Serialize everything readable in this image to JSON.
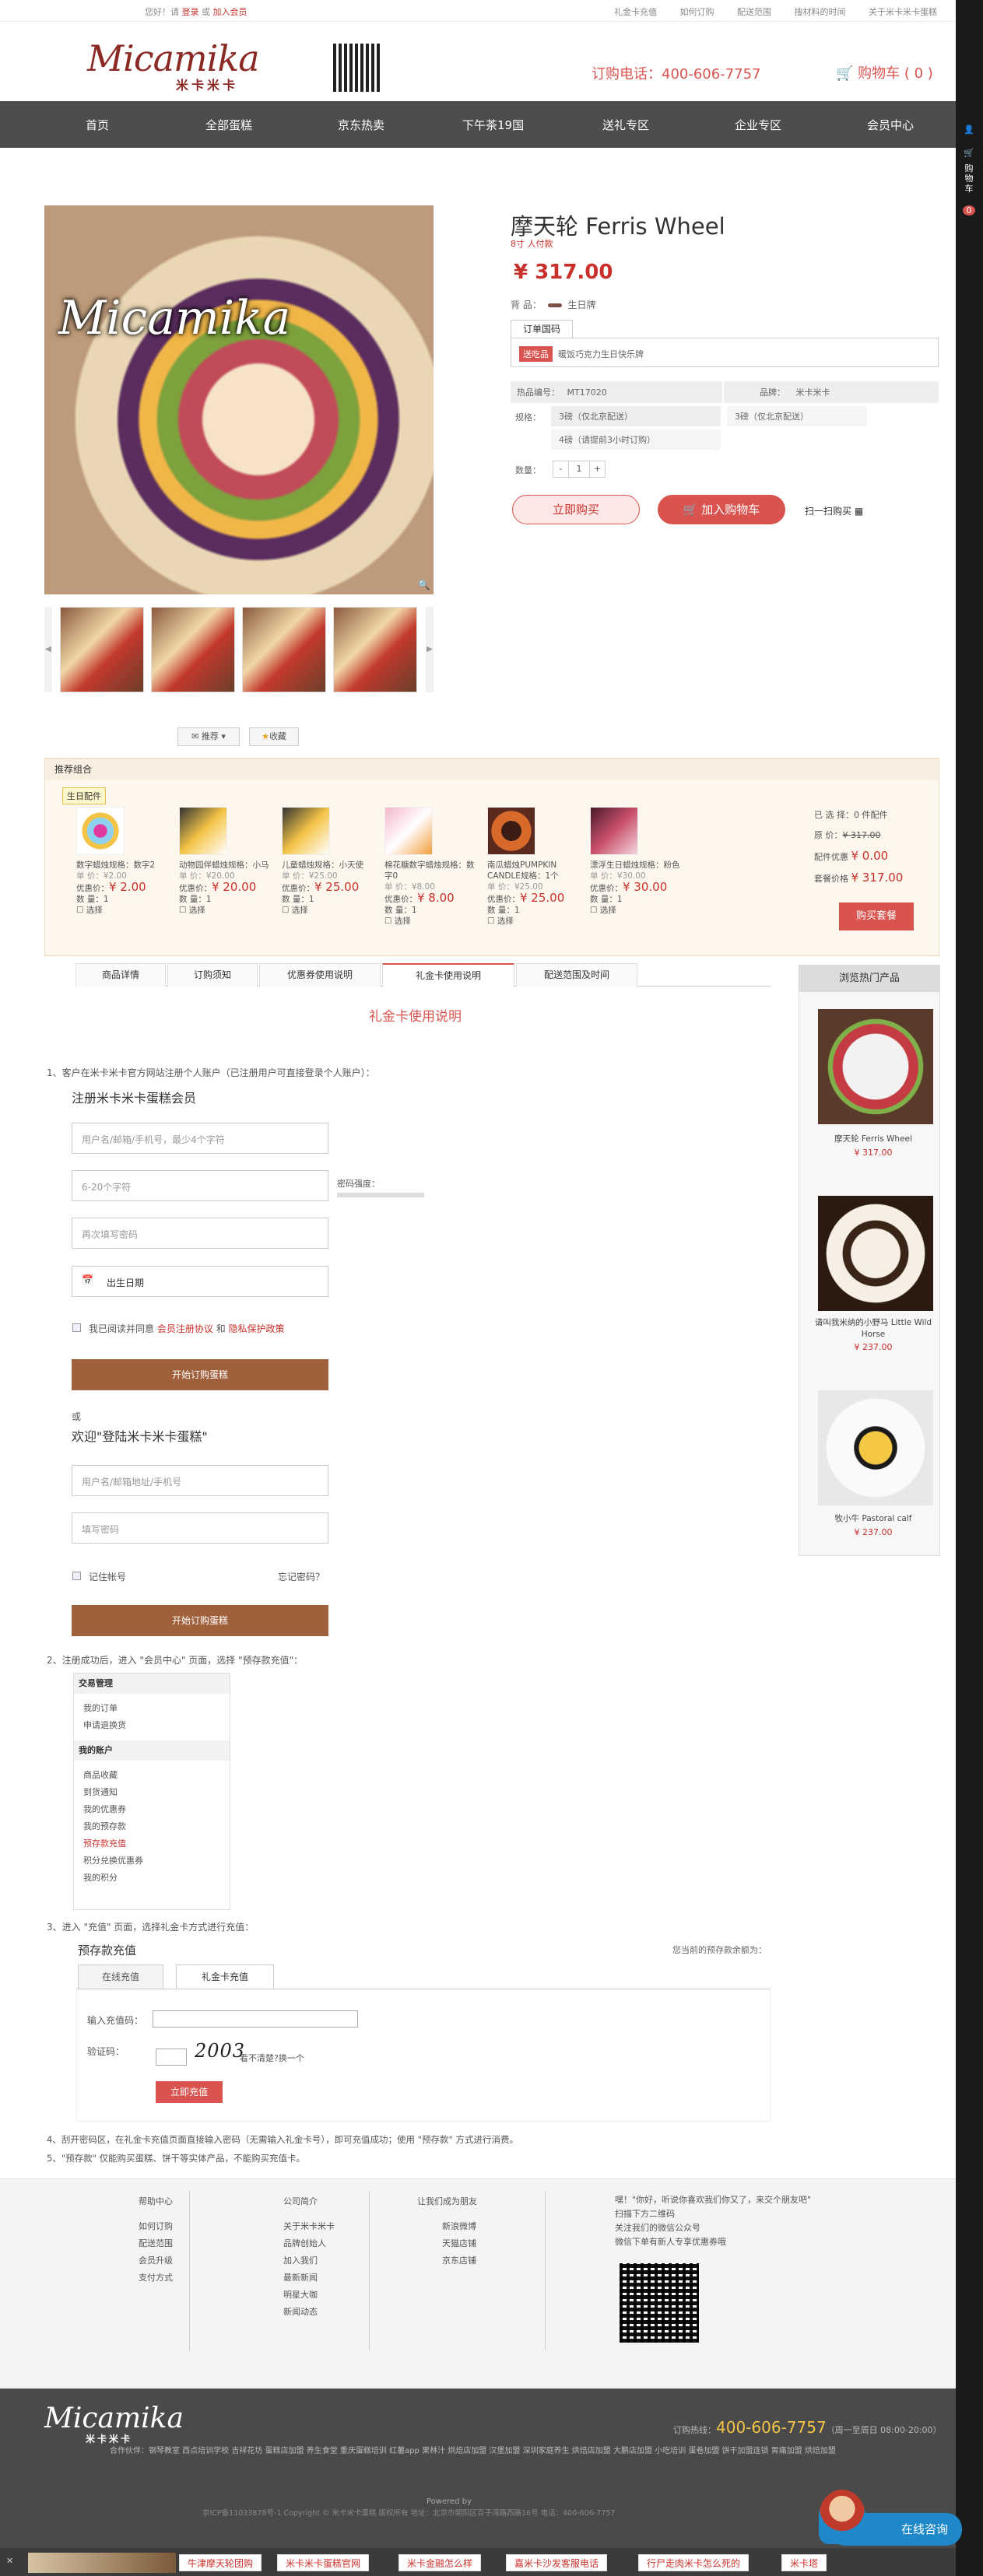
{
  "topbar": {
    "greet": "您好！请",
    "login": "登录",
    "or": "或",
    "register": "加入会员",
    "links": [
      "礼金卡充值",
      "如何订购",
      "配送范围",
      "搜材料的时间",
      "关于米卡米卡蛋糕"
    ]
  },
  "header": {
    "logo": "Micamika",
    "logo_cn": "米卡米卡",
    "hotline": "订购电话：400-606-7757",
    "cart": "购物车 ( 0 )"
  },
  "nav": [
    "首页",
    "全部蛋糕",
    "京东热卖",
    "下午茶19国",
    "送礼专区",
    "企业专区",
    "会员中心"
  ],
  "sidebar": {
    "label": "购物车",
    "count": "0"
  },
  "product": {
    "title": "摩天轮 Ferris Wheel",
    "sub": "8寸 人付款",
    "price": "¥ 317.00",
    "brand_label": "背  品：",
    "brand_value": "生日牌",
    "order_tab": "订单国码",
    "order_tag": "送吃品",
    "order_text": "暖饭巧克力生日快乐牌",
    "sku_label": "热品编号：",
    "sku": "MT17020",
    "brand_k": "品牌：",
    "brand_v": "米卡米卡",
    "spec_label": "规格：",
    "specs": [
      "3磅（仅北京配送）",
      "3磅（仅北京配送）",
      "4磅（请提前3小时订购）"
    ],
    "qty_label": "数量：",
    "qty": "1",
    "buy": "立即购买",
    "add_cart": "加入购物车",
    "scan": "扫一扫购买",
    "share": "推荐",
    "fav": "收藏"
  },
  "combo": {
    "title": "推荐组合",
    "tag": "生日配件",
    "items": [
      {
        "name": "数字蜡烛规格：数字2",
        "unit": "单  价：¥2.00",
        "price": "¥ 2.00",
        "qty": "数  量：1",
        "sel": "选择"
      },
      {
        "name": "动物园伴蜡烛规格：小马",
        "unit": "单  价：¥20.00",
        "price": "¥ 20.00",
        "qty": "数  量：1",
        "sel": "选择"
      },
      {
        "name": "儿童蜡烛规格：小天使",
        "unit": "单  价：¥25.00",
        "price": "¥ 25.00",
        "qty": "数  量：1",
        "sel": "选择"
      },
      {
        "name": "棉花糖数字蜡烛规格：数字0",
        "unit": "单  价：¥8.00",
        "price": "¥ 8.00",
        "qty": "数  量：1",
        "sel": "选择"
      },
      {
        "name": "南瓜蜡烛PUMPKIN CANDLE规格：1个",
        "unit": "单  价：¥25.00",
        "price": "¥ 25.00",
        "qty": "数  量：1",
        "sel": "选择"
      },
      {
        "name": "漂浮生日蜡烛规格：粉色",
        "unit": "单  价：¥30.00",
        "price": "¥ 30.00",
        "qty": "数  量：1",
        "sel": "选择"
      }
    ],
    "discount_label": "优惠价：",
    "selected": "已 选 择：0 件配件",
    "orig_label": "原  价：",
    "orig": "¥ 317.00",
    "save_label": "配件优惠",
    "save": "¥ 0.00",
    "set_label": "套餐价格",
    "set": "¥ 317.00",
    "buy": "购买套餐"
  },
  "tabs": [
    "商品详情",
    "订购须知",
    "优惠券使用说明",
    "礼金卡使用说明",
    "配送范围及时间"
  ],
  "gift": {
    "title": "礼金卡使用说明",
    "step1": "1、客户在米卡米卡官方网站注册个人账户（已注册用户可直接登录个人账户）：",
    "reg_title": "注册米卡米卡蛋糕会员",
    "reg_ph": [
      "用户名/邮箱/手机号，最少4个字符",
      "6-20个字符",
      "再次填写密码"
    ],
    "strength": "密码强度：",
    "birthday": "出生日期",
    "agree": "我已阅读并同意",
    "agree_link1": "会员注册协议",
    "agree_and": "和",
    "agree_link2": "隐私保护政策",
    "reg_btn": "开始订购蛋糕",
    "or": "或",
    "login_title": "欢迎\"登陆米卡米卡蛋糕\"",
    "login_ph": [
      "用户名/邮箱地址/手机号",
      "填写密码"
    ],
    "remember": "记住帐号",
    "forgot": "忘记密码？",
    "login_btn": "开始订购蛋糕",
    "step2": "2、注册成功后，进入 \"会员中心\" 页面，选择 \"预存款充值\"：",
    "menu": {
      "h1": "交易管理",
      "g1": [
        "我的订单",
        "申请退换货"
      ],
      "h2": "我的账户",
      "g2": [
        "商品收藏",
        "到货通知",
        "我的优惠券",
        "我的预存款",
        "预存款充值",
        "积分兑换优惠券",
        "我的积分"
      ]
    },
    "step3": "3、进入 \"充值\" 页面，选择礼金卡方式进行充值：",
    "recharge_title": "预存款充值",
    "balance": "您当前的预存款余额为：",
    "rtab1": "在线充值",
    "rtab2": "礼金卡充值",
    "code_label": "输入充值码：",
    "captcha_label": "验证码：",
    "captcha": "2003",
    "captcha_hint": "看不清楚?换一个",
    "rbtn": "立即充值",
    "step4": "4、刮开密码区，在礼金卡充值页面直接输入密码（无需输入礼金卡号），即可充值成功；使用 \"预存款\" 方式进行消费。",
    "step5": "5、\"预存款\" 仅能购买蛋糕、饼干等实体产品，不能购买充值卡。"
  },
  "hot": {
    "title": "浏览热门产品",
    "items": [
      {
        "name": "摩天轮 Ferris Wheel",
        "price": "¥ 317.00"
      },
      {
        "name": "请叫我米纳的小野马 Little Wild Horse",
        "price": "¥ 237.00"
      },
      {
        "name": "牧小牛 Pastoral calf",
        "price": "¥ 237.00"
      }
    ]
  },
  "footer": {
    "col1": {
      "h": "帮助中心",
      "items": [
        "如何订购",
        "配送范围",
        "会员升级",
        "支付方式"
      ]
    },
    "col2": {
      "h": "公司简介",
      "items": [
        "关于米卡米卡",
        "品牌创始人",
        "加入我们",
        "最新新闻",
        "明星大咖",
        "新闻动态"
      ]
    },
    "col3": {
      "h": "让我们成为朋友",
      "items": [
        "新浪微博",
        "天猫店铺",
        "京东店铺"
      ]
    },
    "wechat": [
      "嘿！\"你好，听说你喜欢我们你又了，来交个朋友吧\"",
      "扫描下方二维码",
      "关注我们的微信公众号",
      "微信下单有新人专享优惠券哦"
    ]
  },
  "footer2": {
    "logo": "Micamika",
    "logo_cn": "米卡米卡",
    "hot_label": "订购热线：",
    "hot": "400-606-7757",
    "hours": "（周一至周日 08:00-20:00）",
    "links": "合作伙伴：钢琴教室 西点培训学校 吉祥花坊 蛋糕店加盟 养生食堂 重庆蛋糕培训 红薯app 果林汁 烘焙店加盟 汉堡加盟 深圳家庭养生 烘焙店加盟 大鹏店加盟 小吃培训 蛋卷加盟 饼干加盟连锁 胃痛加盟 烘焙加盟",
    "powered": "Powered by",
    "copy": "京ICP备11033878号-1 Copyright © 米卡米卡蛋糕 版权所有 地址：北京市朝阳区百子湾路西路16号 电话：400-606-7757"
  },
  "bottombar": [
    "牛津摩天轮团购",
    "米卡米卡蛋糕官网",
    "米卡金融怎么样",
    "嘉米卡沙发客服电话",
    "行尸走肉米卡怎么死的",
    "米卡塔"
  ],
  "online": "在线咨询",
  "colors": {
    "accent": "#d9534f",
    "brand": "#8b2a24",
    "nav": "#4d4d4d",
    "button_brown": "#a0603c"
  }
}
